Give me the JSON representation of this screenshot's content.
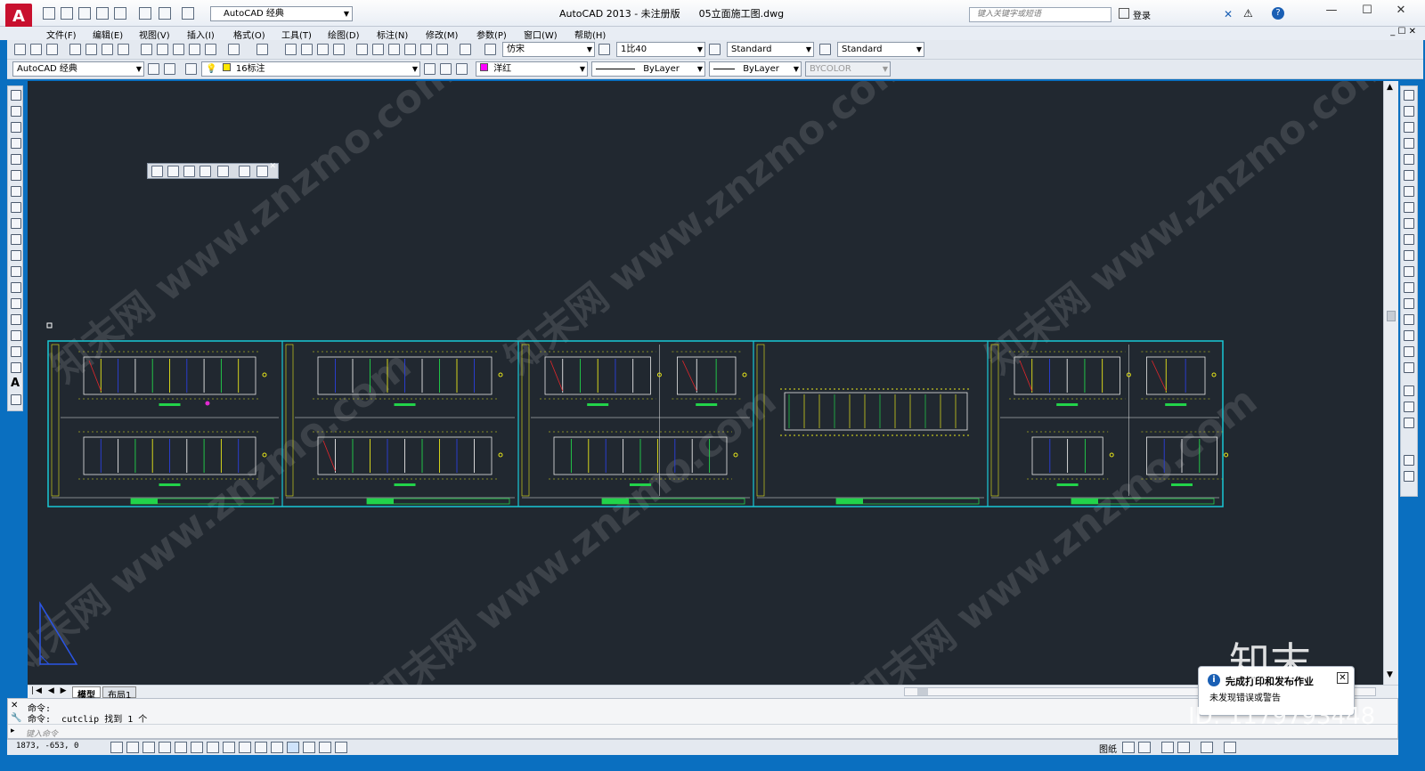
{
  "titlebar": {
    "app_logo": "A",
    "workspace": "AutoCAD 经典",
    "title": "AutoCAD 2013 - 未注册版      05立面施工图.dwg",
    "search_placeholder": "键入关键字或短语",
    "login": "登录"
  },
  "menu": [
    "文件(F)",
    "编辑(E)",
    "视图(V)",
    "插入(I)",
    "格式(O)",
    "工具(T)",
    "绘图(D)",
    "标注(N)",
    "修改(M)",
    "参数(P)",
    "窗口(W)",
    "帮助(H)"
  ],
  "toolbar1": {
    "text_style": "仿宋",
    "dim_scale": "1比40",
    "table_style": "Standard",
    "multileader_style": "Standard"
  },
  "toolbar2": {
    "workspace": "AutoCAD 经典",
    "layer": "16标注",
    "color": "洋红",
    "linetype": "ByLayer",
    "lineweight": "ByLayer",
    "plotstyle": "BYCOLOR"
  },
  "colors": {
    "canvas_bg": "#212830",
    "frame_border": "#19c7d6",
    "drawing_yellow": "#e7e61a",
    "drawing_green": "#22d34a",
    "drawing_white": "#e8e8e8",
    "drawing_red": "#e6262a",
    "drawing_blue": "#2b3fdc",
    "drawing_magenta": "#e12ad1",
    "layer_color_magenta": "#ff00ff"
  },
  "watermark_text": "知末网 www.znzmo.com",
  "layout_tabs": [
    "模型",
    "布局1"
  ],
  "command": {
    "line1": "命令:",
    "line2": "命令: _cutclip 找到 1 个",
    "input_placeholder": "键入命令"
  },
  "status": {
    "coords": "1873, -653, 0",
    "model_label": "图纸"
  },
  "notification": {
    "title": "完成打印和发布作业",
    "message": "未发现错误或警告"
  },
  "overlay": {
    "brand": "知末",
    "id": "ID: 1179793448"
  }
}
